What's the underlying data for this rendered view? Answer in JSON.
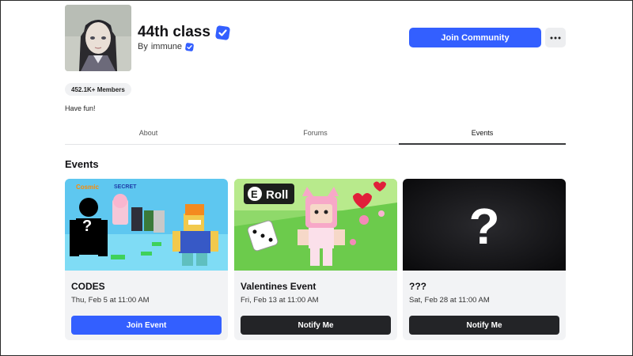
{
  "group": {
    "name": "44th class",
    "owner_prefix": "By",
    "owner": "immune",
    "members": "452.1K+ Members",
    "description": "Have fun!",
    "join_label": "Join Community",
    "more_icon": "more-horizontal-icon"
  },
  "tabs": [
    {
      "label": "About",
      "active": false
    },
    {
      "label": "Forums",
      "active": false
    },
    {
      "label": "Events",
      "active": true
    }
  ],
  "events_section": {
    "title": "Events",
    "cards": [
      {
        "title": "CODES",
        "date": "Thu, Feb 5 at 11:00 AM",
        "button": "Join Event",
        "button_style": "primary",
        "image_text": {
          "top_left": "Cosmic",
          "secret": "SECRET"
        }
      },
      {
        "title": "Valentines Event",
        "date": "Fri, Feb 13 at 11:00 AM",
        "button": "Notify Me",
        "button_style": "dark",
        "image_text": {
          "key": "E",
          "word": "Roll"
        }
      },
      {
        "title": "???",
        "date": "Sat, Feb 28 at 11:00 AM",
        "button": "Notify Me",
        "button_style": "dark",
        "image_text": {
          "mark": "?"
        }
      }
    ]
  },
  "colors": {
    "accent": "#335fff",
    "dark_button": "#232427",
    "card_bg": "#f2f3f5",
    "verified": "#335fff"
  }
}
